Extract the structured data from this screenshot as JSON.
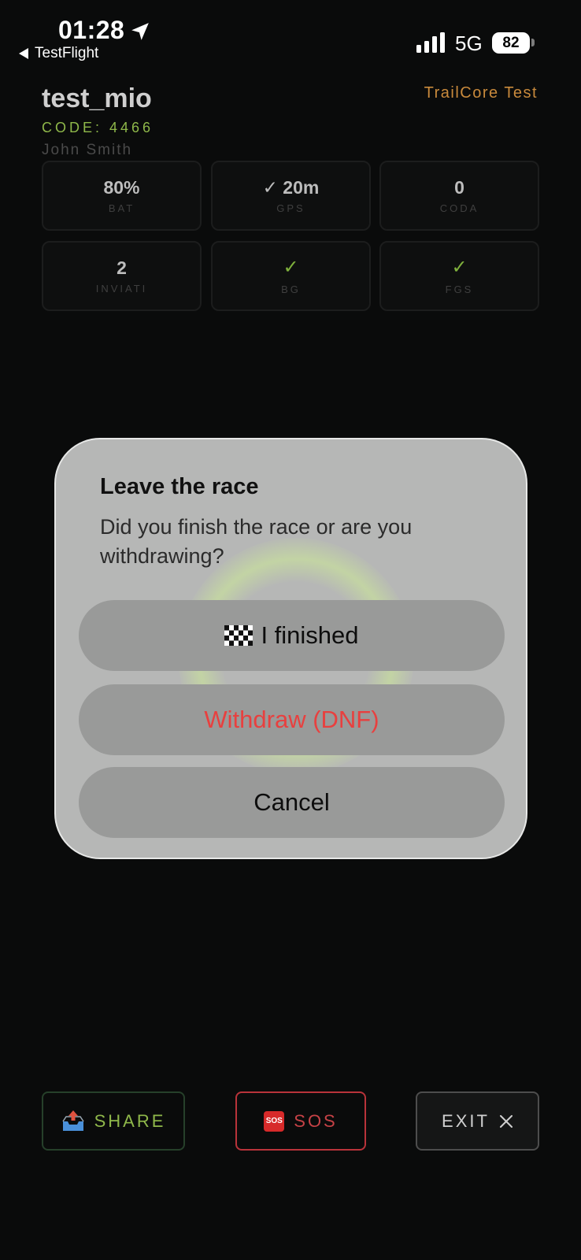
{
  "status_bar": {
    "time": "01:28",
    "back_label": "TestFlight",
    "network": "5G",
    "battery": "82"
  },
  "header": {
    "title": "test_mio",
    "brand": "TrailCore Test",
    "code": "CODE: 4466",
    "runner": "John Smith"
  },
  "stats": [
    {
      "value": "80%",
      "label": "BAT"
    },
    {
      "value": "✓ 20m",
      "label": "GPS"
    },
    {
      "value": "0",
      "label": "CODA"
    },
    {
      "value": "2",
      "label": "INVIATI"
    },
    {
      "value": "✓",
      "label": "BG"
    },
    {
      "value": "✓",
      "label": "FGS"
    }
  ],
  "dialog": {
    "title": "Leave the race",
    "message": "Did you finish the race or are you withdrawing?",
    "finished_label": "I finished",
    "withdraw_label": "Withdraw (DNF)",
    "cancel_label": "Cancel"
  },
  "bottom_bar": {
    "share_label": "SHARE",
    "sos_icon_text": "SOS",
    "sos_label": "SOS",
    "exit_label": "EXIT"
  },
  "colors": {
    "background": "#0a0b0b",
    "accent_green": "#8fb84a",
    "brand_orange": "#c98a3c",
    "danger_red": "#e8403f",
    "dialog_bg": "#b6b7b6"
  },
  "icons": [
    "location-arrow-icon",
    "back-triangle-icon",
    "cellular-signal-icon",
    "battery-icon",
    "checkered-flag-icon",
    "outbox-tray-icon",
    "sos-icon",
    "close-icon"
  ]
}
